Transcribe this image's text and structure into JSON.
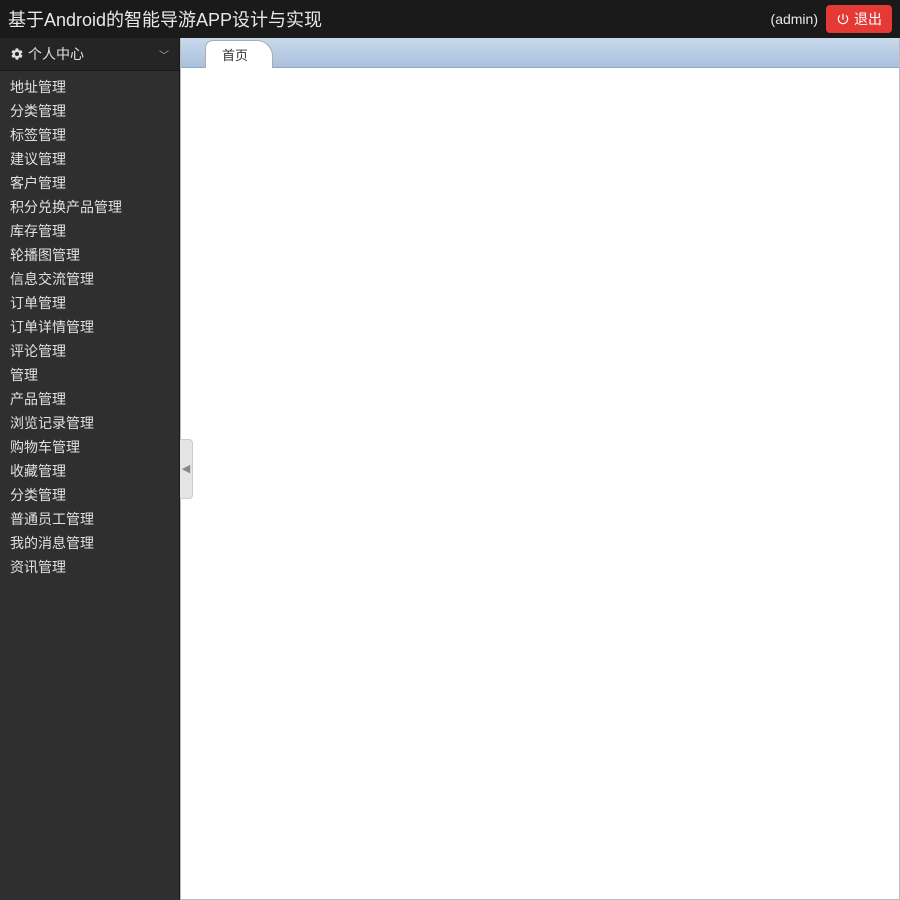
{
  "header": {
    "title": "基于Android的智能导游APP设计与实现",
    "user": "(admin)",
    "logout_label": "退出"
  },
  "sidebar": {
    "section_title": "个人中心",
    "items": [
      "地址管理",
      "分类管理",
      "标签管理",
      "建议管理",
      "客户管理",
      "积分兑换产品管理",
      "库存管理",
      "轮播图管理",
      "信息交流管理",
      "订单管理",
      "订单详情管理",
      "评论管理",
      "管理",
      "产品管理",
      "浏览记录管理",
      "购物车管理",
      "收藏管理",
      "分类管理",
      "普通员工管理",
      "我的消息管理",
      "资讯管理"
    ]
  },
  "tabs": {
    "active": "首页"
  },
  "collapse_arrow": "◀"
}
